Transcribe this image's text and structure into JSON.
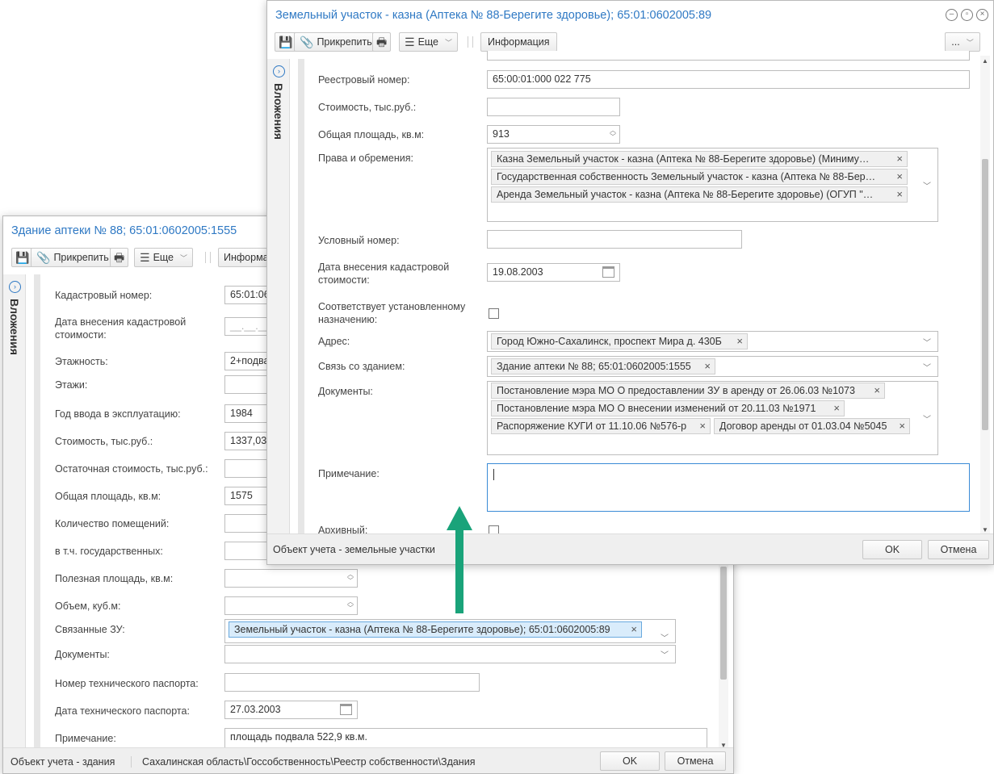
{
  "back_window": {
    "title": "Здание аптеки № 88; 65:01:0602005:1555",
    "toolbar": {
      "attach": "Прикрепить",
      "more": "Еще",
      "info": "Информа"
    },
    "side_label": "Вложения",
    "fields": {
      "cadastral_number": {
        "label": "Кадастровый номер:",
        "value": "65:01:06"
      },
      "cadastral_date": {
        "label": "Дата внесения кадастровой стоимости:",
        "value": "__.__.__"
      },
      "floors_count": {
        "label": "Этажность:",
        "value": "2+подва"
      },
      "floors": {
        "label": "Этажи:",
        "value": ""
      },
      "year": {
        "label": "Год ввода в эксплуатацию:",
        "value": "1984"
      },
      "cost": {
        "label": "Стоимость, тыс.руб.:",
        "value": "1337,03"
      },
      "residual_cost": {
        "label": "Остаточная стоимость, тыс.руб.:",
        "value": ""
      },
      "area": {
        "label": "Общая площадь, кв.м:",
        "value": "1575"
      },
      "rooms": {
        "label": "Количество помещений:",
        "value": ""
      },
      "state_rooms": {
        "label": "в т.ч. государственных:",
        "value": ""
      },
      "useful_area": {
        "label": "Полезная площадь, кв.м:",
        "value": ""
      },
      "volume": {
        "label": "Объем, куб.м:",
        "value": ""
      },
      "linked_land": {
        "label": "Связанные ЗУ:",
        "tag": "Земельный участок - казна (Аптека № 88-Берегите здоровье); 65:01:0602005:89"
      },
      "documents": {
        "label": "Документы:",
        "value": ""
      },
      "passport_number": {
        "label": "Номер технического паспорта:",
        "value": ""
      },
      "passport_date": {
        "label": "Дата технического паспорта:",
        "value": "27.03.2003"
      },
      "note": {
        "label": "Примечание:",
        "value": "площадь подвала 522,9 кв.м."
      }
    },
    "footer": {
      "type": "Объект учета - здания",
      "path": "Сахалинская область\\Госсобственность\\Реестр собственности\\Здания",
      "ok": "OK",
      "cancel": "Отмена"
    }
  },
  "front_window": {
    "title": "Земельный участок - казна (Аптека № 88-Берегите здоровье); 65:01:0602005:89",
    "toolbar": {
      "attach": "Прикрепить",
      "more": "Еще",
      "info": "Информация",
      "ellipsis": "..."
    },
    "side_label": "Вложения",
    "fields": {
      "registry_number": {
        "label": "Реестровый номер:",
        "value": "65:00:01:000 022 775"
      },
      "cost": {
        "label": "Стоимость, тыс.руб.:",
        "value": ""
      },
      "area": {
        "label": "Общая площадь, кв.м:",
        "value": "913"
      },
      "rights": {
        "label": "Права и обремения:",
        "tags": [
          "Казна Земельный участок - казна (Аптека № 88-Берегите здоровье) (Миниму…",
          "Государственная собственность Земельный участок - казна (Аптека № 88-Бер…",
          "Аренда Земельный участок - казна (Аптека № 88-Берегите здоровье) (ОГУП \"…"
        ]
      },
      "conditional_number": {
        "label": "Условный номер:",
        "value": ""
      },
      "cadastral_date": {
        "label": "Дата внесения кадастровой стоимости:",
        "value": "19.08.2003"
      },
      "purpose": {
        "label": "Соответствует установленному назначению:",
        "checked": false
      },
      "address": {
        "label": "Адрес:",
        "tag": "Город Южно-Сахалинск, проспект Мира д. 430Б"
      },
      "building_link": {
        "label": "Связь со зданием:",
        "tag": "Здание аптеки № 88; 65:01:0602005:1555"
      },
      "documents": {
        "label": "Документы:",
        "tags": [
          "Постановление мэра МО О предоставлении ЗУ в аренду от 26.06.03 №1073",
          "Постановление мэра МО О внесении изменений от 20.11.03 №1971",
          "Распоряжение КУГИ от 11.10.06 №576-р",
          "Договор аренды от 01.03.04 №5045"
        ]
      },
      "note": {
        "label": "Примечание:",
        "value": ""
      },
      "archived": {
        "label": "Архивный:",
        "checked": false
      }
    },
    "footer": {
      "type": "Объект учета - земельные участки",
      "ok": "OK",
      "cancel": "Отмена"
    }
  },
  "colors": {
    "title": "#2f79c4",
    "annotation_arrow": "#1aa37a",
    "tag_highlight": "#d9ecfb"
  }
}
